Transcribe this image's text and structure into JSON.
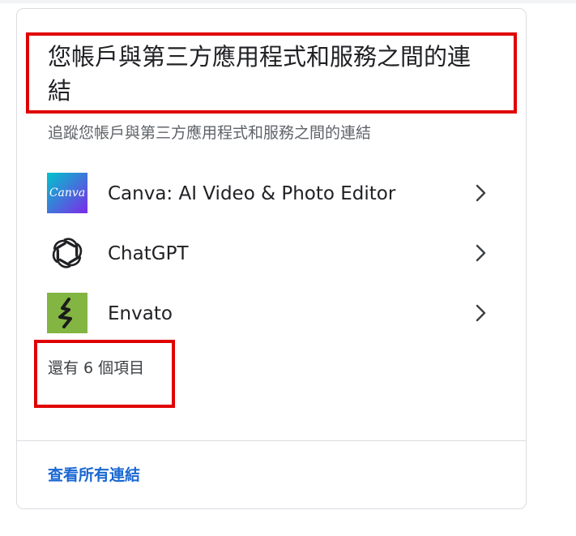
{
  "card": {
    "title": "您帳戶與第三方應用程式和服務之間的連結",
    "subtitle": "追蹤您帳戶與第三方應用程式和服務之間的連結",
    "apps": [
      {
        "name": "Canva: AI Video & Photo Editor",
        "icon": "canva-logo-icon",
        "icon_text": "Canva"
      },
      {
        "name": "ChatGPT",
        "icon": "openai-logo-icon"
      },
      {
        "name": "Envato",
        "icon": "envato-logo-icon"
      }
    ],
    "more_items": "還有 6 個項目",
    "view_all": "查看所有連結"
  },
  "colors": {
    "highlight": "#e00000",
    "link": "#1967d2",
    "canva_gradient_start": "#00c4cc",
    "canva_gradient_end": "#7d2ae8",
    "envato": "#82b541"
  }
}
